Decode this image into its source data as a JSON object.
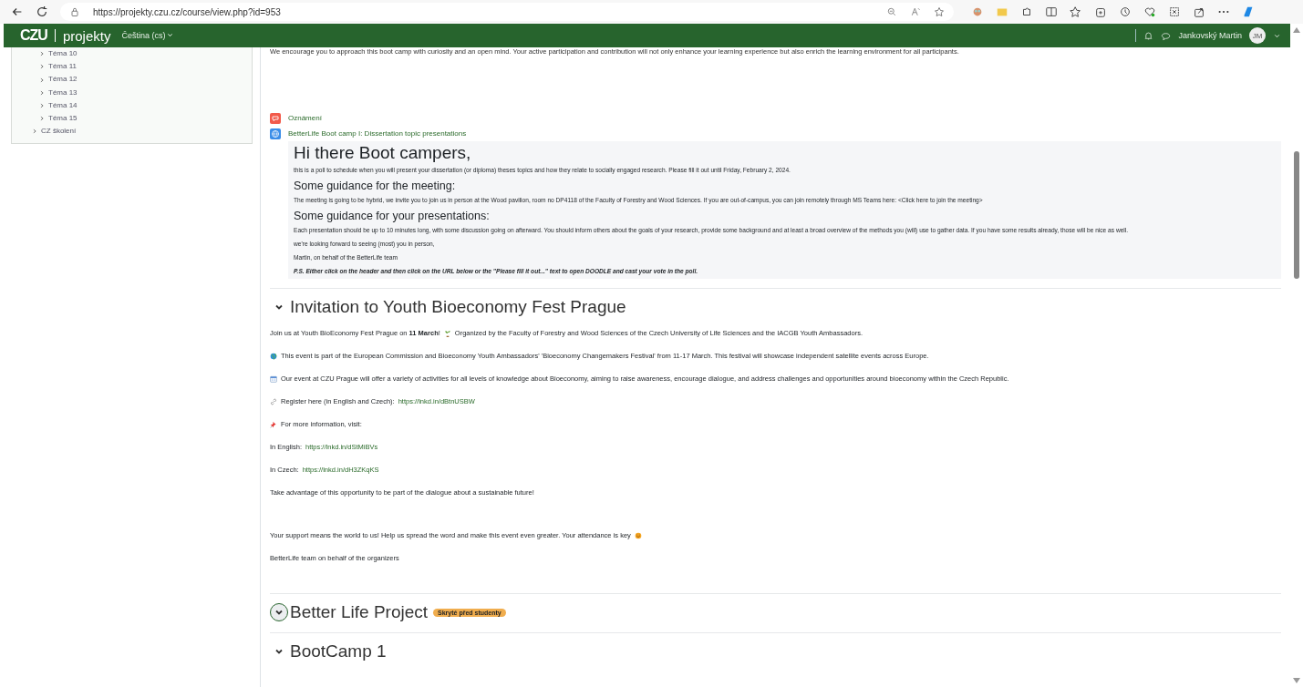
{
  "browser": {
    "url": "https://projekty.czu.cz/course/view.php?id=953"
  },
  "header": {
    "logo": "CZU",
    "site": "projekty",
    "language": "Čeština (cs)",
    "user": "Jankovský Martin",
    "avatar": "JM"
  },
  "sidebar": {
    "items": [
      {
        "children": [
          {
            "label": "Téma 10",
            "expanded": false
          },
          {
            "label": "Téma 11",
            "expanded": false
          },
          {
            "label": "Téma 12",
            "expanded": false
          },
          {
            "label": "Téma 13",
            "expanded": false
          },
          {
            "label": "Téma 14",
            "expanded": false
          },
          {
            "label": "Téma 15",
            "expanded": false
          }
        ]
      },
      {
        "label": "CZ školení",
        "expanded": false
      }
    ]
  },
  "intro_text": "We encourage you to approach this boot camp with curiosity and an open mind. Your active participation and contribution will not only enhance your learning experience but also enrich the learning environment for all participants.",
  "activities": [
    {
      "kind": "forum",
      "name": "Oznámení"
    },
    {
      "kind": "url",
      "name": "BetterLife Boot camp I: Dissertation topic presentations"
    }
  ],
  "description": [
    {
      "kind": "title",
      "text": "Hi there Boot campers,"
    },
    {
      "kind": "para",
      "text": "this is a poll to schedule when you will present your dissertation (or diploma) theses topics and how they relate to socially engaged research. Please fill it out until Friday, February 2, 2024."
    },
    {
      "kind": "heading",
      "text": "Some guidance for the meeting:"
    },
    {
      "kind": "para",
      "text": "The meeting is going to be hybrid, we invite you to join us in person at the Wood pavilion, room no DP4118 of the Faculty of Forestry and Wood Sciences. If you are out-of-campus, you can join remotely through MS Teams here: <Click here to join the meeting>"
    },
    {
      "kind": "heading",
      "text": "Some guidance for your presentations:"
    },
    {
      "kind": "para",
      "text": "Each presentation should be up to 10 minutes long, with some discussion going on afterward. You should inform others about the goals of your research, provide some background and at least a broad overview of the methods you (will) use to gather data. If you have some results already, those will be nice as well."
    },
    {
      "kind": "para",
      "text": "we're looking forward to seeing (most) you in person,"
    },
    {
      "kind": "para",
      "text": "Martin, on behalf of the BetterLife team"
    },
    {
      "kind": "note",
      "text": "P.S. Either click on the header and then click on the URL below or the \"Please fill it out...\" text to open DOODLE and cast your vote in the poll."
    }
  ],
  "sections": [
    {
      "title": "Invitation to Youth Bioeconomy Fest Prague",
      "expanded": true,
      "focused": false,
      "paragraphs": [
        [
          {
            "kind": "text",
            "text": "Join us at Youth BioEconomy Fest Prague on **11 March**!"
          },
          {
            "kind": "seedling"
          },
          {
            "kind": "text",
            "text": "Organized by the Faculty of Forestry and Wood Sciences of the Czech University of Life Sciences and the IACGB Youth Ambassadors."
          }
        ],
        [
          {
            "kind": "globe"
          },
          {
            "kind": "text",
            "text": "This event is part of the European Commission and Bioeconomy Youth Ambassadors' 'Bioeconomy Changemakers Festival' from 11-17 March. This festival will showcase independent satellite events across Europe."
          }
        ],
        [
          {
            "kind": "calendar"
          },
          {
            "kind": "text",
            "text": "Our event at CZU Prague will offer a variety of activities for all levels of knowledge about Bioeconomy, aiming to raise awareness, encourage dialogue, and address challenges and opportunities around bioeconomy within the Czech Republic."
          }
        ],
        [
          {
            "kind": "chain"
          },
          {
            "kind": "text",
            "text": "Register here (in English and Czech):"
          },
          {
            "kind": "link",
            "text": "https://lnkd.in/dBtnUSBW"
          }
        ],
        [
          {
            "kind": "pin"
          },
          {
            "kind": "text",
            "text": "For more information, visit:"
          }
        ],
        [
          {
            "kind": "text",
            "text": "In English:"
          },
          {
            "kind": "link",
            "text": "https://lnkd.in/dStMiBVs"
          }
        ],
        [
          {
            "kind": "text",
            "text": "In Czech:"
          },
          {
            "kind": "link",
            "text": "https://lnkd.in/dH3ZKqKS"
          }
        ],
        [
          {
            "kind": "text",
            "text": "Take advantage of this opportunity to be part of the dialogue about a sustainable future!"
          }
        ],
        [
          {
            "kind": "gap"
          }
        ],
        [
          {
            "kind": "text",
            "text": "Your support means the world to us! Help us spread the word and make this event even greater. Your attendance is key"
          },
          {
            "kind": "smiley"
          }
        ],
        [
          {
            "kind": "text",
            "text": "BetterLife team on behalf of the organizers"
          }
        ]
      ]
    },
    {
      "title": "Better Life Project",
      "badge": "Skryté před studenty",
      "expanded": true,
      "focused": true
    },
    {
      "title": "BootCamp 1",
      "expanded": true,
      "focused": false
    }
  ]
}
